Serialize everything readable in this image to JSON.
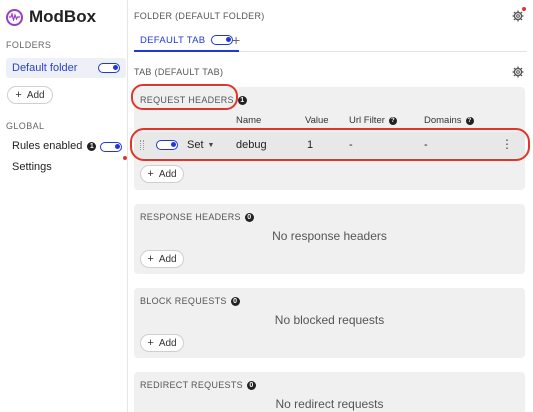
{
  "app": {
    "name": "ModBox"
  },
  "sidebar": {
    "folders_label": "FOLDERS",
    "folder": {
      "label": "Default folder",
      "enabled": true
    },
    "add_label": "Add",
    "global_label": "GLOBAL",
    "rules_enabled_label": "Rules enabled",
    "rules_enabled_count": "1",
    "settings_label": "Settings"
  },
  "main": {
    "folder_title": "FOLDER (DEFAULT FOLDER)",
    "tab": {
      "label": "DEFAULT TAB",
      "enabled": true
    },
    "tab_title": "TAB (DEFAULT TAB)",
    "request_headers": {
      "title": "REQUEST HEADERS",
      "count": "1",
      "columns": {
        "name": "Name",
        "value": "Value",
        "url_filter": "Url Filter",
        "domains": "Domains"
      },
      "row": {
        "enabled": true,
        "operation": "Set",
        "name": "debug",
        "value": "1",
        "url_filter": "-",
        "domains": "-"
      },
      "add_label": "Add"
    },
    "response_headers": {
      "title": "RESPONSE HEADERS",
      "count": "0",
      "empty": "No response headers",
      "add_label": "Add"
    },
    "block_requests": {
      "title": "BLOCK REQUESTS",
      "count": "0",
      "empty": "No blocked requests",
      "add_label": "Add"
    },
    "redirect_requests": {
      "title": "REDIRECT REQUESTS",
      "count": "0",
      "empty": "No redirect requests"
    }
  },
  "icons": {
    "logo": "waveform-logo-icon",
    "gear": "gear-icon",
    "plus": "plus-icon",
    "info": "info-icon",
    "help": "help-icon",
    "caret": "caret-down-icon",
    "kebab": "kebab-menu-icon",
    "drag": "drag-handle-icon"
  },
  "colors": {
    "accent": "#2238d6",
    "brand": "#9b3fc4",
    "annotation": "#e0352b",
    "panel": "#f0f0f0",
    "selected_folder": "#eef0f7"
  }
}
